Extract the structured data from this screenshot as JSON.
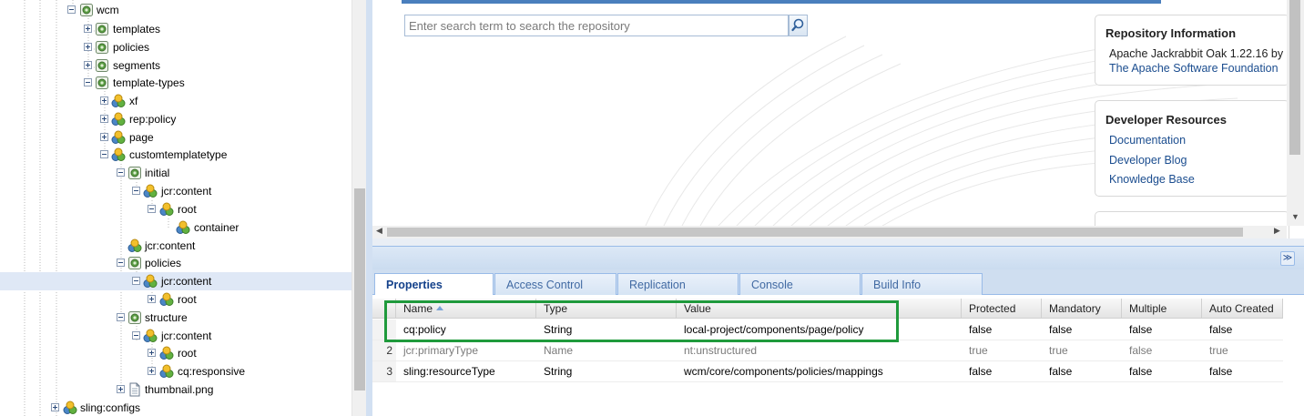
{
  "tree": {
    "nodes": [
      {
        "label": "wcm",
        "icon": "folder-node-icon",
        "state": "open"
      },
      {
        "label": "templates",
        "icon": "folder-node-icon",
        "state": "closed"
      },
      {
        "label": "policies",
        "icon": "folder-node-icon",
        "state": "closed"
      },
      {
        "label": "segments",
        "icon": "folder-node-icon",
        "state": "closed"
      },
      {
        "label": "template-types",
        "icon": "folder-node-icon",
        "state": "open"
      },
      {
        "label": "xf",
        "icon": "unstructured-node-icon",
        "state": "closed"
      },
      {
        "label": "rep:policy",
        "icon": "unstructured-node-icon",
        "state": "closed"
      },
      {
        "label": "page",
        "icon": "unstructured-node-icon",
        "state": "closed"
      },
      {
        "label": "customtemplatetype",
        "icon": "unstructured-node-icon",
        "state": "open"
      },
      {
        "label": "initial",
        "icon": "folder-node-icon",
        "state": "open"
      },
      {
        "label": "jcr:content",
        "icon": "unstructured-node-icon",
        "state": "open"
      },
      {
        "label": "root",
        "icon": "unstructured-node-icon",
        "state": "open"
      },
      {
        "label": "container",
        "icon": "unstructured-node-icon",
        "state": "leaf"
      },
      {
        "label": "jcr:content",
        "icon": "unstructured-node-icon",
        "state": "leaf"
      },
      {
        "label": "policies",
        "icon": "folder-node-icon",
        "state": "open"
      },
      {
        "label": "jcr:content",
        "icon": "unstructured-node-icon",
        "state": "open",
        "selected": true
      },
      {
        "label": "root",
        "icon": "unstructured-node-icon",
        "state": "closed"
      },
      {
        "label": "structure",
        "icon": "folder-node-icon",
        "state": "open"
      },
      {
        "label": "jcr:content",
        "icon": "unstructured-node-icon",
        "state": "open"
      },
      {
        "label": "root",
        "icon": "unstructured-node-icon",
        "state": "closed"
      },
      {
        "label": "cq:responsive",
        "icon": "unstructured-node-icon",
        "state": "closed"
      },
      {
        "label": "thumbnail.png",
        "icon": "file-node-icon",
        "state": "closed"
      },
      {
        "label": "sling:configs",
        "icon": "unstructured-node-icon",
        "state": "closed"
      }
    ]
  },
  "search": {
    "placeholder": "Enter search term to search the repository",
    "button_icon": "magnifier-icon"
  },
  "repository_info": {
    "title": "Repository Information",
    "line1": "Apache Jackrabbit Oak 1.22.16 by",
    "line2": "The Apache Software Foundation"
  },
  "developer_resources": {
    "title": "Developer Resources",
    "links": [
      "Documentation",
      "Developer Blog",
      "Knowledge Base"
    ]
  },
  "tabs": [
    {
      "label": "Properties",
      "active": true
    },
    {
      "label": "Access Control",
      "active": false
    },
    {
      "label": "Replication",
      "active": false
    },
    {
      "label": "Console",
      "active": false
    },
    {
      "label": "Build Info",
      "active": false
    }
  ],
  "grid": {
    "columns": [
      "Name",
      "Type",
      "Value",
      "Protected",
      "Mandatory",
      "Multiple",
      "Auto Created"
    ],
    "rows": [
      {
        "num": "",
        "name": "cq:policy",
        "type": "String",
        "value": "local-project/components/page/policy",
        "protected": "false",
        "mandatory": "false",
        "multiple": "false",
        "auto_created": "false",
        "dim": false
      },
      {
        "num": "2",
        "name": "jcr:primaryType",
        "type": "Name",
        "value": "nt:unstructured",
        "protected": "true",
        "mandatory": "true",
        "multiple": "false",
        "auto_created": "true",
        "dim": true
      },
      {
        "num": "3",
        "name": "sling:resourceType",
        "type": "String",
        "value": "wcm/core/components/policies/mappings",
        "protected": "false",
        "mandatory": "false",
        "multiple": "false",
        "auto_created": "false",
        "dim": false
      }
    ]
  },
  "colors": {
    "highlight": "#1f9a3c",
    "selection": "#dfe8f6",
    "link": "#1b4d8f"
  }
}
